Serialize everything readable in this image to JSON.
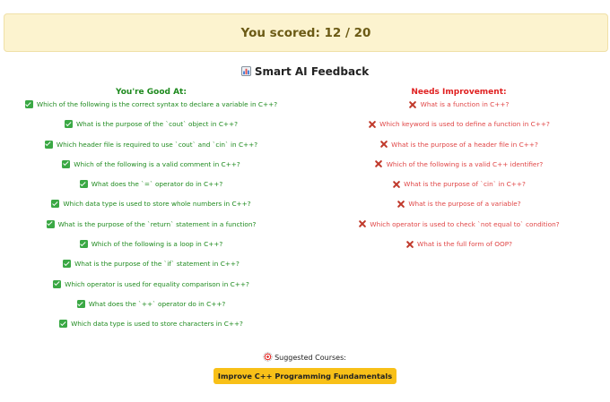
{
  "score": {
    "label": "You scored: 12 / 20"
  },
  "feedback": {
    "title": "Smart AI Feedback",
    "title_icon": "bar-chart-icon"
  },
  "good": {
    "heading": "You're Good At:",
    "icon": "check-mark-icon",
    "color": "#1e8a1e",
    "items": [
      "Which of the following is the correct syntax to declare a variable in C++?",
      "What is the purpose of the `cout` object in C++?",
      "Which header file is required to use `cout` and `cin` in C++?",
      "Which of the following is a valid comment in C++?",
      "What does the `=` operator do in C++?",
      "Which data type is used to store whole numbers in C++?",
      "What is the purpose of the `return` statement in a function?",
      "Which of the following is a loop in C++?",
      "What is the purpose of the `if` statement in C++?",
      "Which operator is used for equality comparison in C++?",
      "What does the `++` operator do in C++?",
      "Which data type is used to store characters in C++?"
    ]
  },
  "improve": {
    "heading": "Needs Improvement:",
    "icon": "cross-mark-icon",
    "color": "#e02020",
    "items": [
      "What is a function in C++?",
      "Which keyword is used to define a function in C++?",
      "What is the purpose of a header file in C++?",
      "Which of the following is a valid C++ identifier?",
      "What is the purpose of `cin` in C++?",
      "What is the purpose of a variable?",
      "Which operator is used to check `not equal to` condition?",
      "What is the full form of OOP?"
    ]
  },
  "courses": {
    "label": "Suggested Courses:",
    "icon": "target-icon",
    "items": [
      "Improve C++ Programming Fundamentals"
    ],
    "button_color": "#f8c018"
  }
}
